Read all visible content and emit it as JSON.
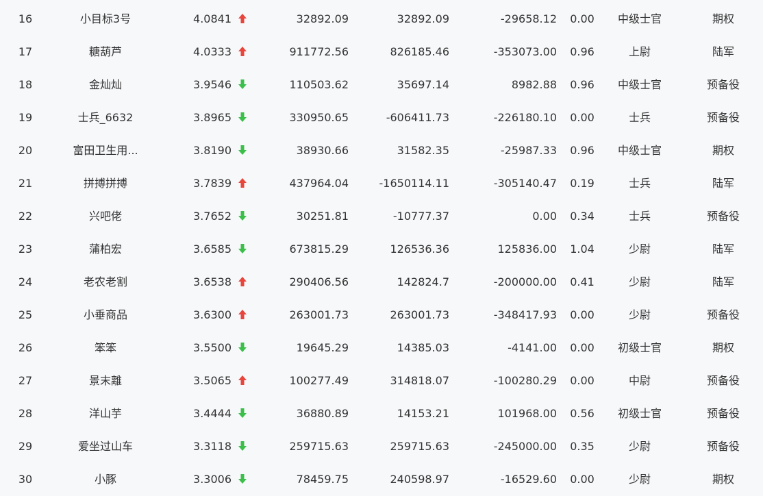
{
  "colors": {
    "background": "#f7f8fa",
    "text": "#333333",
    "up": "#e8453c",
    "down": "#3bbf4a"
  },
  "rows": [
    {
      "rank": "16",
      "name": "小目标3号",
      "score": "4.0841",
      "trend": "up",
      "v1": "32892.09",
      "v2": "32892.09",
      "v3": "-29658.12",
      "ratio": "0.00",
      "level": "中级士官",
      "category": "期权"
    },
    {
      "rank": "17",
      "name": "糖葫芦",
      "score": "4.0333",
      "trend": "up",
      "v1": "911772.56",
      "v2": "826185.46",
      "v3": "-353073.00",
      "ratio": "0.96",
      "level": "上尉",
      "category": "陆军"
    },
    {
      "rank": "18",
      "name": "金灿灿",
      "score": "3.9546",
      "trend": "down",
      "v1": "110503.62",
      "v2": "35697.14",
      "v3": "8982.88",
      "ratio": "0.96",
      "level": "中级士官",
      "category": "预备役"
    },
    {
      "rank": "19",
      "name": "士兵_6632",
      "score": "3.8965",
      "trend": "down",
      "v1": "330950.65",
      "v2": "-606411.73",
      "v3": "-226180.10",
      "ratio": "0.00",
      "level": "士兵",
      "category": "预备役"
    },
    {
      "rank": "20",
      "name": "富田卫生用...",
      "score": "3.8190",
      "trend": "down",
      "v1": "38930.66",
      "v2": "31582.35",
      "v3": "-25987.33",
      "ratio": "0.96",
      "level": "中级士官",
      "category": "期权"
    },
    {
      "rank": "21",
      "name": "拼搏拼搏",
      "score": "3.7839",
      "trend": "up",
      "v1": "437964.04",
      "v2": "-1650114.11",
      "v3": "-305140.47",
      "ratio": "0.19",
      "level": "士兵",
      "category": "陆军"
    },
    {
      "rank": "22",
      "name": "兴吧佬",
      "score": "3.7652",
      "trend": "down",
      "v1": "30251.81",
      "v2": "-10777.37",
      "v3": "0.00",
      "ratio": "0.34",
      "level": "士兵",
      "category": "预备役"
    },
    {
      "rank": "23",
      "name": "蒲柏宏",
      "score": "3.6585",
      "trend": "down",
      "v1": "673815.29",
      "v2": "126536.36",
      "v3": "125836.00",
      "ratio": "1.04",
      "level": "少尉",
      "category": "陆军"
    },
    {
      "rank": "24",
      "name": "老农老割",
      "score": "3.6538",
      "trend": "up",
      "v1": "290406.56",
      "v2": "142824.7",
      "v3": "-200000.00",
      "ratio": "0.41",
      "level": "少尉",
      "category": "陆军"
    },
    {
      "rank": "25",
      "name": "小垂商品",
      "score": "3.6300",
      "trend": "up",
      "v1": "263001.73",
      "v2": "263001.73",
      "v3": "-348417.93",
      "ratio": "0.00",
      "level": "少尉",
      "category": "预备役"
    },
    {
      "rank": "26",
      "name": "笨笨",
      "score": "3.5500",
      "trend": "down",
      "v1": "19645.29",
      "v2": "14385.03",
      "v3": "-4141.00",
      "ratio": "0.00",
      "level": "初级士官",
      "category": "期权"
    },
    {
      "rank": "27",
      "name": "景末離",
      "score": "3.5065",
      "trend": "up",
      "v1": "100277.49",
      "v2": "314818.07",
      "v3": "-100280.29",
      "ratio": "0.00",
      "level": "中尉",
      "category": "预备役"
    },
    {
      "rank": "28",
      "name": "洋山芋",
      "score": "3.4444",
      "trend": "down",
      "v1": "36880.89",
      "v2": "14153.21",
      "v3": "101968.00",
      "ratio": "0.56",
      "level": "初级士官",
      "category": "预备役"
    },
    {
      "rank": "29",
      "name": "爱坐过山车",
      "score": "3.3118",
      "trend": "down",
      "v1": "259715.63",
      "v2": "259715.63",
      "v3": "-245000.00",
      "ratio": "0.35",
      "level": "少尉",
      "category": "预备役"
    },
    {
      "rank": "30",
      "name": "小豚",
      "score": "3.3006",
      "trend": "down",
      "v1": "78459.75",
      "v2": "240598.97",
      "v3": "-16529.60",
      "ratio": "0.00",
      "level": "少尉",
      "category": "期权"
    }
  ]
}
